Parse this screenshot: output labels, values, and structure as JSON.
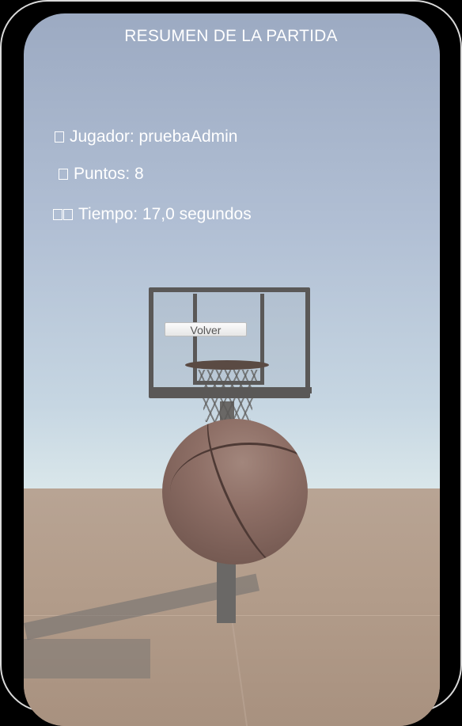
{
  "screen": {
    "title": "RESUMEN DE LA PARTIDA"
  },
  "summary": {
    "player": "Jugador: pruebaAdmin",
    "points": "Puntos: 8",
    "time": "Tiempo: 17,0 segundos"
  },
  "actions": {
    "back_label": "Volver"
  },
  "scene": {
    "sky_color": "#b1bfd4",
    "court_color": "#b39d8b",
    "ball_color": "#8e6f66",
    "hoop_color": "#5a5857"
  }
}
